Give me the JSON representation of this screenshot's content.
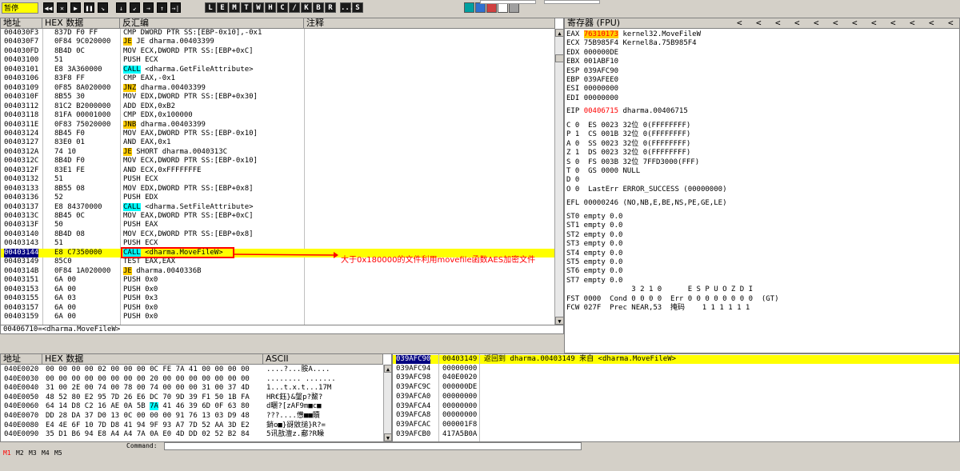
{
  "toolbar": {
    "status": "暂停",
    "nav_buttons": [
      "◀◀",
      "✕",
      "▶",
      "❚❚",
      "↘",
      "↓",
      "↙",
      "→",
      "↑",
      "→|"
    ],
    "window_letters": [
      "L",
      "E",
      "M",
      "T",
      "W",
      "H",
      "C",
      "/",
      "K",
      "B",
      "R",
      "...",
      "S"
    ],
    "plugin_icons": [
      "list-icon",
      "grid-icon",
      "tag-icon",
      "table-icon",
      "help-icon"
    ]
  },
  "disasm": {
    "headers": {
      "address": "地址",
      "hex": "HEX 数据",
      "asm": "反汇编",
      "comment": "注释"
    },
    "rows": [
      {
        "addr": "004030F3",
        "hex": "837D F0 FF",
        "asm": "CMP DWORD PTR SS:[EBP-0x10],-0x1",
        "style": ""
      },
      {
        "addr": "004030F7",
        "hex": "0F84 9C020000",
        "asm": "JE dharma.00403399",
        "style": "",
        "tag": "JE"
      },
      {
        "addr": "004030FD",
        "hex": "8B4D 0C",
        "asm": "MOV ECX,DWORD PTR SS:[EBP+0xC]",
        "style": ""
      },
      {
        "addr": "00403100",
        "hex": "51",
        "asm": "PUSH ECX",
        "style": ""
      },
      {
        "addr": "00403101",
        "hex": "E8 3A360000",
        "asm": "<dharma.GetFileAttribute>",
        "style": "",
        "tag": "CALL"
      },
      {
        "addr": "00403106",
        "hex": "83F8 FF",
        "asm": "CMP EAX,-0x1",
        "style": ""
      },
      {
        "addr": "00403109",
        "hex": "0F85 8A020000",
        "asm": "dharma.00403399",
        "style": "",
        "tag": "JNZ"
      },
      {
        "addr": "0040310F",
        "hex": "8B55 30",
        "asm": "MOV EDX,DWORD PTR SS:[EBP+0x30]",
        "style": ""
      },
      {
        "addr": "00403112",
        "hex": "81C2 B2000000",
        "asm": "ADD EDX,0xB2",
        "style": ""
      },
      {
        "addr": "00403118",
        "hex": "81FA 00001000",
        "asm": "CMP EDX,0x100000",
        "style": ""
      },
      {
        "addr": "0040311E",
        "hex": "0F83 75020000",
        "asm": "dharma.00403399",
        "style": "",
        "tag": "JNB"
      },
      {
        "addr": "00403124",
        "hex": "8B45 F0",
        "asm": "MOV EAX,DWORD PTR SS:[EBP-0x10]",
        "style": ""
      },
      {
        "addr": "00403127",
        "hex": "83E0 01",
        "asm": "AND EAX,0x1",
        "style": ""
      },
      {
        "addr": "0040312A",
        "hex": "74 10",
        "asm": "SHORT dharma.0040313C",
        "style": "",
        "tag": "JE"
      },
      {
        "addr": "0040312C",
        "hex": "8B4D F0",
        "asm": "MOV ECX,DWORD PTR SS:[EBP-0x10]",
        "style": ""
      },
      {
        "addr": "0040312F",
        "hex": "83E1 FE",
        "asm": "AND ECX,0xFFFFFFFE",
        "style": ""
      },
      {
        "addr": "00403132",
        "hex": "51",
        "asm": "PUSH ECX",
        "style": ""
      },
      {
        "addr": "00403133",
        "hex": "8B55 08",
        "asm": "MOV EDX,DWORD PTR SS:[EBP+0x8]",
        "style": ""
      },
      {
        "addr": "00403136",
        "hex": "52",
        "asm": "PUSH EDX",
        "style": ""
      },
      {
        "addr": "00403137",
        "hex": "E8 84370000",
        "asm": "<dharma.SetFileAttribute>",
        "style": "",
        "tag": "CALL"
      },
      {
        "addr": "0040313C",
        "hex": "8B45 0C",
        "asm": "MOV EAX,DWORD PTR SS:[EBP+0xC]",
        "style": ""
      },
      {
        "addr": "0040313F",
        "hex": "50",
        "asm": "PUSH EAX",
        "style": ""
      },
      {
        "addr": "00403140",
        "hex": "8B4D 08",
        "asm": "MOV ECX,DWORD PTR SS:[EBP+0x8]",
        "style": ""
      },
      {
        "addr": "00403143",
        "hex": "51",
        "asm": "PUSH ECX",
        "style": ""
      },
      {
        "addr": "00403144",
        "hex": "E8 C7350000",
        "asm": "<dharma.MoveFileW>",
        "style": "sel",
        "tag": "CALL"
      },
      {
        "addr": "00403149",
        "hex": "85C0",
        "asm": "TEST EAX,EAX",
        "style": ""
      },
      {
        "addr": "0040314B",
        "hex": "0F84 1A020000",
        "asm": "dharma.0040336B",
        "style": "",
        "tag": "JE"
      },
      {
        "addr": "00403151",
        "hex": "6A 00",
        "asm": "PUSH 0x0",
        "style": ""
      },
      {
        "addr": "00403153",
        "hex": "6A 00",
        "asm": "PUSH 0x0",
        "style": ""
      },
      {
        "addr": "00403155",
        "hex": "6A 03",
        "asm": "PUSH 0x3",
        "style": ""
      },
      {
        "addr": "00403157",
        "hex": "6A 00",
        "asm": "PUSH 0x0",
        "style": ""
      },
      {
        "addr": "00403159",
        "hex": "6A 00",
        "asm": "PUSH 0x0",
        "style": ""
      }
    ],
    "annotation": "大于0x180000的文件利用movefile函数AES加密文件",
    "info_line": "00406710=<dharma.MoveFileW>"
  },
  "registers": {
    "header": "寄存器 (FPU)",
    "nav_arrows": [
      "<",
      "<",
      "<",
      "<",
      "<",
      "<",
      "<",
      "<",
      "<",
      "<",
      "<",
      "<"
    ],
    "lines": [
      {
        "name": "EAX",
        "value": "76310173",
        "comment": "kernel32.MoveFileW",
        "hl": "orange"
      },
      {
        "name": "ECX",
        "value": "75B985F4",
        "comment": "Kernel8a.75B985F4"
      },
      {
        "name": "EDX",
        "value": "000000DE",
        "comment": ""
      },
      {
        "name": "EBX",
        "value": "001ABF10",
        "comment": ""
      },
      {
        "name": "ESP",
        "value": "039AFC90",
        "comment": ""
      },
      {
        "name": "EBP",
        "value": "039AFEE0",
        "comment": ""
      },
      {
        "name": "ESI",
        "value": "00000000",
        "comment": ""
      },
      {
        "name": "EDI",
        "value": "00000000",
        "comment": ""
      }
    ],
    "eip": {
      "name": "EIP",
      "value": "00406715",
      "comment": "dharma.00406715"
    },
    "flags": [
      "C 0  ES 0023 32位 0(FFFFFFFF)",
      "P 1  CS 001B 32位 0(FFFFFFFF)",
      "A 0  SS 0023 32位 0(FFFFFFFF)",
      "Z 1  DS 0023 32位 0(FFFFFFFF)",
      "S 0  FS 003B 32位 7FFD3000(FFF)",
      "T 0  GS 0000 NULL",
      "D 0",
      "O 0  LastErr ERROR_SUCCESS (00000000)"
    ],
    "efl": "EFL 00000246 (NO,NB,E,BE,NS,PE,GE,LE)",
    "fpu": [
      "ST0 empty 0.0",
      "ST1 empty 0.0",
      "ST2 empty 0.0",
      "ST3 empty 0.0",
      "ST4 empty 0.0",
      "ST5 empty 0.0",
      "ST6 empty 0.0",
      "ST7 empty 0.0"
    ],
    "fpu_bits_header": "               3 2 1 0      E S P U O Z D I",
    "fst": "FST 0000  Cond 0 0 0 0  Err 0 0 0 0 0 0 0 0  (GT)",
    "fcw": "FCW 027F  Prec NEAR,53  掩码    1 1 1 1 1 1"
  },
  "dump": {
    "headers": {
      "address": "地址",
      "hex": "HEX 数据",
      "ascii": "ASCII"
    },
    "rows": [
      {
        "addr": "040E0020",
        "hex": "00 00 00 00 02 00 00 00 0C FE 7A 41 00 00 00 00",
        "ascii": "....?...胺A...."
      },
      {
        "addr": "040E0030",
        "hex": "00 00 00 00 00 00 00 00 20 00 00 00 00 00 00 00",
        "ascii": "........ ......."
      },
      {
        "addr": "040E0040",
        "hex": "31 00 2E 00 74 00 78 00 74 00 00 00 31 00 37 4D",
        "ascii": "1...t.x.t...17M"
      },
      {
        "addr": "040E0050",
        "hex": "48 52 80 E2 95 7D 26 E6 DC 70 9D 39 F1 50 1B FA",
        "ascii": "HR€鈺}&鎜p?鯬?"
      },
      {
        "addr": "040E0060",
        "hex": "64 14 D8 C2 16 AE 0A 5B 7A 41 46 39 6D 0F 63 80",
        "ascii": "d曬?[zAF9m■c■"
      },
      {
        "addr": "040E0070",
        "hex": "DD 28 DA 37 D0 13 0C 00 00 00 91 76 13 03 D9 48",
        "ascii": "???....憊■■贖"
      },
      {
        "addr": "040E0080",
        "hex": "E4 4E 6F 10 7D D8 41 94 9F 93 A7 7D 52 AA 3D E2",
        "ascii": "銷o■}谺敓搥}R?="
      },
      {
        "addr": "040E0090",
        "hex": "35 D1 B6 94 E8 A4 A4 7A 0A E0 4D DD 02 52 B2 84",
        "ascii": "5讯敨澶z.郙?R矂"
      }
    ]
  },
  "stack": {
    "rows": [
      {
        "addr": "039AFC90",
        "value": "00403149",
        "comment": "返回到 dharma.00403149 来自 <dharma.MoveFileW>",
        "sel": true
      },
      {
        "addr": "039AFC94",
        "value": "00000000",
        "comment": ""
      },
      {
        "addr": "039AFC98",
        "value": "040E0020",
        "comment": ""
      },
      {
        "addr": "039AFC9C",
        "value": "000000DE",
        "comment": ""
      },
      {
        "addr": "039AFCA0",
        "value": "00000000",
        "comment": ""
      },
      {
        "addr": "039AFCA4",
        "value": "00000000",
        "comment": ""
      },
      {
        "addr": "039AFCA8",
        "value": "00000000",
        "comment": ""
      },
      {
        "addr": "039AFCAC",
        "value": "000001F8",
        "comment": ""
      },
      {
        "addr": "039AFCB0",
        "value": "417A5B0A",
        "comment": ""
      }
    ]
  },
  "bottom": {
    "tabs": [
      "M1",
      "M2",
      "M3",
      "M4",
      "M5"
    ],
    "command_label": "Command:"
  },
  "colors": {
    "selected_row": "#ffff00",
    "call_highlight": "#00ffff",
    "jump_highlight": "#ffcc00",
    "annotation_text": "#ff0000",
    "callout_box": "#ff0000"
  }
}
